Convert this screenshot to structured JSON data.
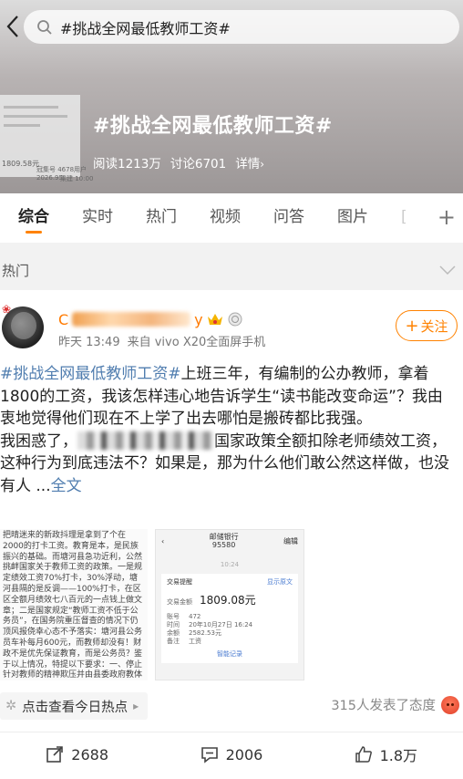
{
  "search": {
    "query": "#挑战全网最低教师工资#"
  },
  "hero": {
    "title": "#挑战全网最低教师工资#",
    "stats": [
      "阅读1213万",
      "讨论6701",
      "详情"
    ],
    "thumb_text": [
      "1809.58元",
      "冠集号 4678用户",
      "2026.95",
      "乘建 10:00"
    ]
  },
  "tabs": [
    "综合",
    "实时",
    "热门",
    "视频",
    "问答",
    "图片",
    "["
  ],
  "section": {
    "title": "热门"
  },
  "post": {
    "author_visible": "C",
    "author_tail": "y",
    "time": "昨天 13:49",
    "source": "来自 vivo X20全面屏手机",
    "follow_label": "关注",
    "tag": "#挑战全网最低教师工资#",
    "text_1": "上班三年，有编制的公办教师，拿着1800的工资，我该怎样违心地告诉学生“读书能改变命运”？我由衷地觉得他们现在不上学了出去哪怕是搬砖都比我强。",
    "text_2a": "我困惑了，",
    "text_2b": "国家政策全额扣除老师绩效工资，这种行为到底违法不？如果是，那为什么他们敢公然这样做，也没有人 ...",
    "more": "全文",
    "image1_text": "把晴迷来的新政抖理是拿到了个在2000的打卡工资。教育是本，是民族振兴的基础。而塘河县急功近利，公然挑衅国家关于教师工资的政策。一是规定绩效工资70%打卡，30%浮动，塘河县隔的是反调——100%打卡，在区区全额月绩效七八百元的一点钱上做文章；二是国家规定“教师工资不低于公务员”，在国务院重压督查的情况下仍顶风报侥幸心态不予落实：塘河县公务员车补每月600元，而教师却没有！财政不是优先保证教育，而是公务员？鉴于以上情况，特提以下要求：一、停止针对教师的精神欺压并由县委政府教体局作诚恳道歉；二、落实工资待遇，增加",
    "image2": {
      "back": "‹",
      "title": "邮储银行",
      "subtitle": "95580",
      "edit": "编辑",
      "date_sep": "10:24",
      "box_title": "交易提醒",
      "box_link": "显示原文",
      "amount_label": "交易金额",
      "amount": "1809.08元",
      "rows": [
        [
          "账号",
          "472"
        ],
        [
          "时间",
          "20年10月27日 16:24"
        ],
        [
          "余额",
          "2582.53元"
        ],
        [
          "备注",
          "工资"
        ]
      ],
      "smart": "智能记录"
    },
    "hot_label": "点击查看今日热点",
    "reactions": "315人发表了态度",
    "shares": "2688",
    "comments": "2006",
    "likes": "1.8万"
  }
}
